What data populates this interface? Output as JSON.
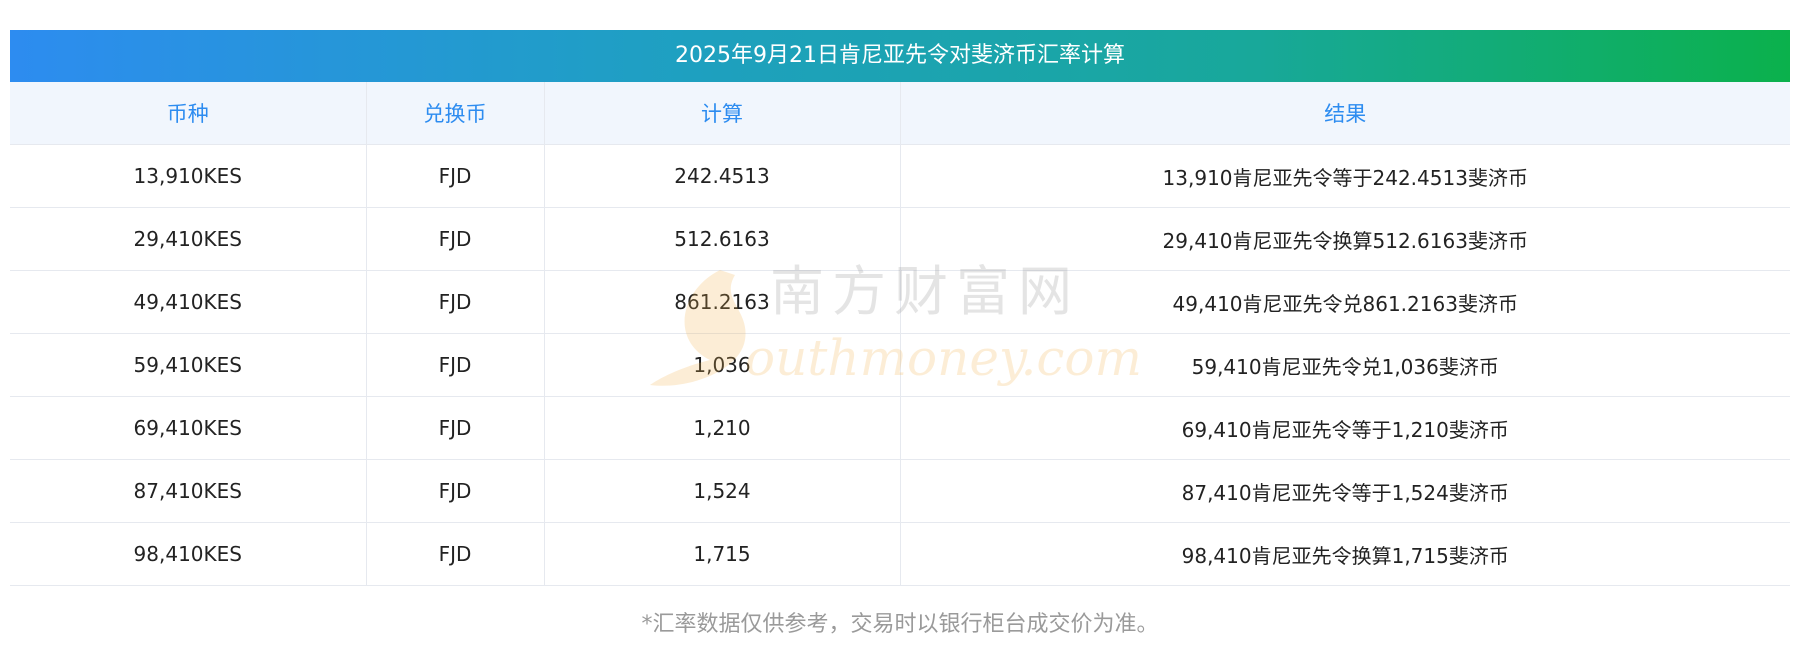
{
  "title": "2025年9月21日肯尼亚先令对斐济币汇率计算",
  "table": {
    "headers": [
      "币种",
      "兑换币",
      "计算",
      "结果"
    ],
    "rows": [
      [
        "13,910KES",
        "FJD",
        "242.4513",
        "13,910肯尼亚先令等于242.4513斐济币"
      ],
      [
        "29,410KES",
        "FJD",
        "512.6163",
        "29,410肯尼亚先令换算512.6163斐济币"
      ],
      [
        "49,410KES",
        "FJD",
        "861.2163",
        "49,410肯尼亚先令兑861.2163斐济币"
      ],
      [
        "59,410KES",
        "FJD",
        "1,036",
        "59,410肯尼亚先令兑1,036斐济币"
      ],
      [
        "69,410KES",
        "FJD",
        "1,210",
        "69,410肯尼亚先令等于1,210斐济币"
      ],
      [
        "87,410KES",
        "FJD",
        "1,524",
        "87,410肯尼亚先令等于1,524斐济币"
      ],
      [
        "98,410KES",
        "FJD",
        "1,715",
        "98,410肯尼亚先令换算1,715斐济币"
      ]
    ]
  },
  "note": "*汇率数据仅供参考，交易时以银行柜台成交价为准。",
  "watermark": {
    "cn": "南方财富网",
    "en": "outhmoney.com"
  },
  "colors": {
    "header_text": "#2d8cf0",
    "header_bg": "#f1f6fd",
    "title_gradient_start": "#2d8cf0",
    "title_gradient_end": "#0bb14c",
    "note_text": "#9a9a9a"
  }
}
